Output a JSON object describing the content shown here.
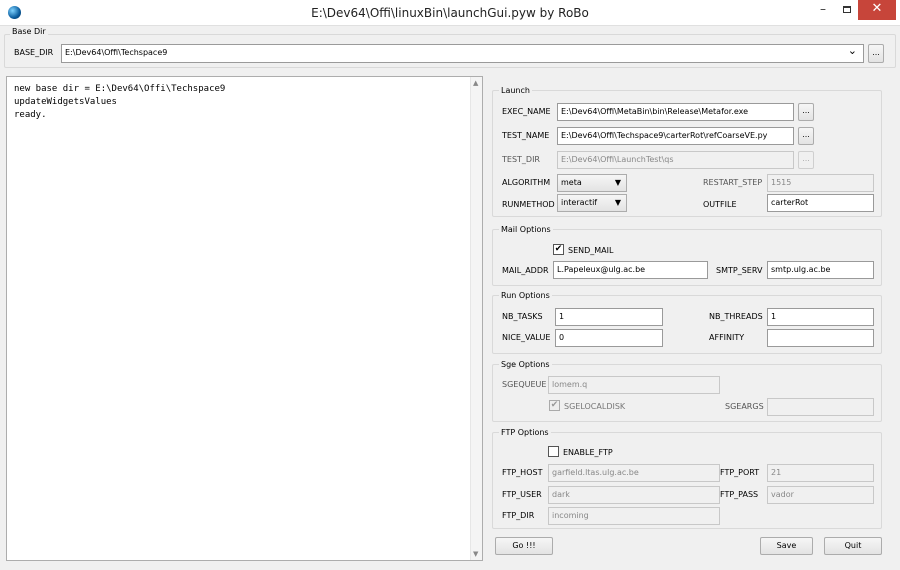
{
  "window": {
    "title": "E:\\Dev64\\Offi\\linuxBin\\launchGui.pyw by RoBo"
  },
  "base_dir": {
    "group_title": "Base Dir",
    "label": "BASE_DIR",
    "value": "E:\\Dev64\\Offi\\Techspace9",
    "browse": "..."
  },
  "log": {
    "lines": [
      "new base dir = E:\\Dev64\\Offi\\Techspace9",
      "updateWidgetsValues",
      "ready."
    ]
  },
  "launch": {
    "title": "Launch",
    "exec_name": {
      "label": "EXEC_NAME",
      "value": "E:\\Dev64\\Offi\\MetaBin\\bin\\Release\\Metafor.exe",
      "browse": "..."
    },
    "test_name": {
      "label": "TEST_NAME",
      "value": "E:\\Dev64\\Offi\\Techspace9\\carterRot\\refCoarseVE.py",
      "browse": "..."
    },
    "test_dir": {
      "label": "TEST_DIR",
      "value": "E:\\Dev64\\Offi\\LaunchTest\\qs",
      "browse": "..."
    },
    "algorithm": {
      "label": "ALGORITHM",
      "value": "meta"
    },
    "restart_step": {
      "label": "RESTART_STEP",
      "value": "1515"
    },
    "runmethod": {
      "label": "RUNMETHOD",
      "value": "interactif"
    },
    "outfile": {
      "label": "OUTFILE",
      "value": "carterRot"
    }
  },
  "mail": {
    "title": "Mail Options",
    "send_mail": {
      "label": "SEND_MAIL",
      "checked": true
    },
    "mail_addr": {
      "label": "MAIL_ADDR",
      "value": "L.Papeleux@ulg.ac.be"
    },
    "smtp_serv": {
      "label": "SMTP_SERV",
      "value": "smtp.ulg.ac.be"
    }
  },
  "run": {
    "title": "Run Options",
    "nb_tasks": {
      "label": "NB_TASKS",
      "value": "1"
    },
    "nb_threads": {
      "label": "NB_THREADS",
      "value": "1"
    },
    "nice_value": {
      "label": "NICE_VALUE",
      "value": "0"
    },
    "affinity": {
      "label": "AFFINITY",
      "value": ""
    }
  },
  "sge": {
    "title": "Sge Options",
    "sgequeue": {
      "label": "SGEQUEUE",
      "value": "lomem.q"
    },
    "sgelocaldisk": {
      "label": "SGELOCALDISK",
      "checked": true
    },
    "sgeargs": {
      "label": "SGEARGS",
      "value": ""
    }
  },
  "ftp": {
    "title": "FTP Options",
    "enable_ftp": {
      "label": "ENABLE_FTP",
      "checked": false
    },
    "ftp_host": {
      "label": "FTP_HOST",
      "value": "garfield.ltas.ulg.ac.be"
    },
    "ftp_port": {
      "label": "FTP_PORT",
      "value": "21"
    },
    "ftp_user": {
      "label": "FTP_USER",
      "value": "dark"
    },
    "ftp_pass": {
      "label": "FTP_PASS",
      "value": "vador"
    },
    "ftp_dir": {
      "label": "FTP_DIR",
      "value": "incoming"
    }
  },
  "buttons": {
    "go": "Go !!!",
    "save": "Save",
    "quit": "Quit"
  },
  "glyphs": {
    "minimize": "–",
    "close": "✕",
    "dropdown": "⌄",
    "check": "✔",
    "scroll_up": "▲",
    "scroll_down": "▼",
    "select_arrow": "▼"
  },
  "colors": {
    "close_button": "#c7453a",
    "window_bg": "#f0f0f0"
  }
}
